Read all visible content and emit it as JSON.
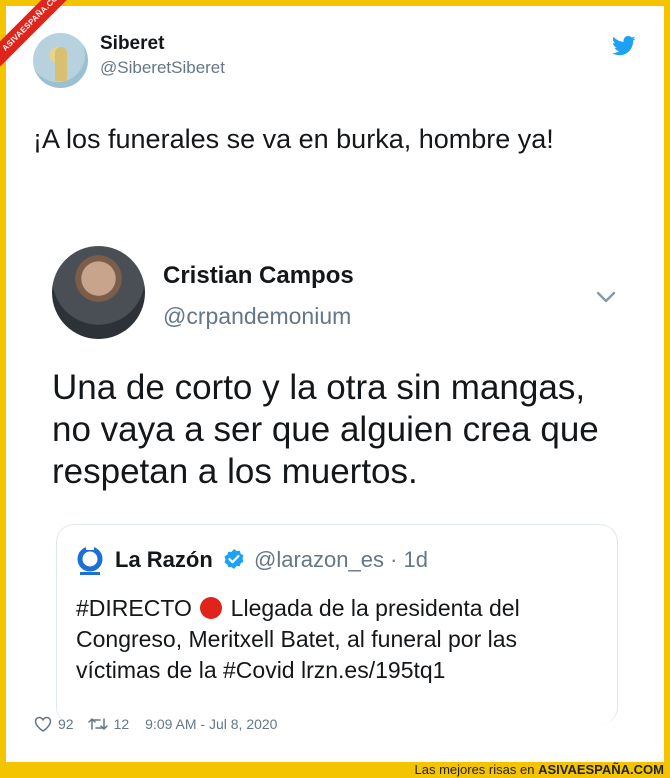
{
  "brand": {
    "ribbon": "ASIVAESPAÑA.COM",
    "tagline": "Las mejores risas en",
    "site": "ASIVAESPAÑA.COM",
    "frame_color": "#f5c400"
  },
  "tweet": {
    "name": "Siberet",
    "handle": "@SiberetSiberet",
    "text": "¡A los funerales se va en burka, hombre ya!",
    "likes": "92",
    "retweets": "12",
    "timestamp": "9:09 AM - Jul 8, 2020",
    "icon": "twitter-bird-icon"
  },
  "embedded": {
    "name": "Cristian Campos",
    "handle": "@crpandemonium",
    "text": "Una de corto y la otra sin mangas, no vaya a ser que alguien crea que respetan a los muertos.",
    "quote": {
      "name": "La Razón",
      "handle": "@larazon_es · 1d",
      "text_before": "#DIRECTO",
      "text_after": "Llegada de la presidenta del Congreso, Meritxell Batet, al funeral por las víctimas de la #Covid lrzn.es/195tq1",
      "logo_label": "LA RAZON"
    }
  }
}
